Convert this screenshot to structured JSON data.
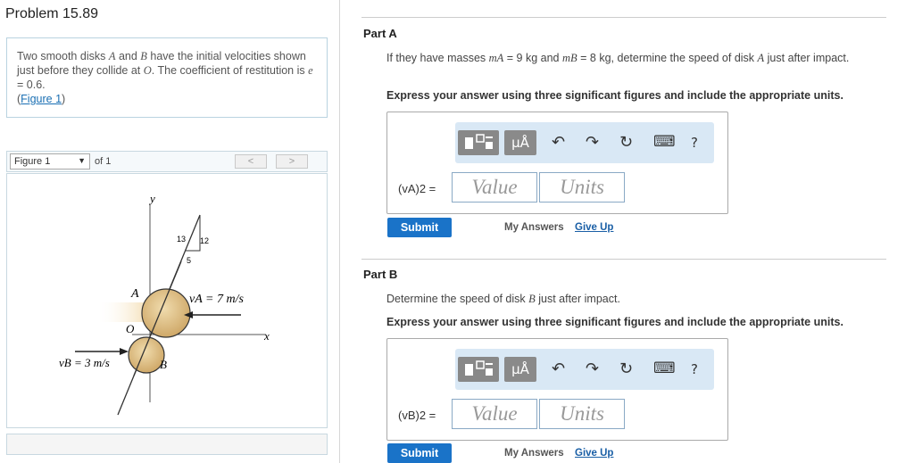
{
  "problem": {
    "title": "Problem 15.89"
  },
  "description": {
    "text1": "Two smooth disks ",
    "A": "A",
    "and": " and ",
    "B": "B",
    "text2": " have the initial velocities shown just before they collide at ",
    "O": "O",
    "text3": ". The coefficient of restitution is ",
    "e": "e",
    "text4": " = 0.6.",
    "open_paren": "(",
    "figure_link": "Figure 1",
    "close_paren": ")"
  },
  "figure_nav": {
    "selected": "Figure 1",
    "of_label": "of 1",
    "prev": "<",
    "next": ">"
  },
  "figure": {
    "label_y": "y",
    "label_x": "x",
    "label_A": "A",
    "label_B": "B",
    "label_O": "O",
    "slope_13": "13",
    "slope_12": "12",
    "slope_5": "5",
    "vA": "vA = 7 m/s",
    "vB": "vB = 3 m/s"
  },
  "partA": {
    "title": "Part A",
    "q1": "If they have masses ",
    "mA": "mA",
    "q2": " = 9 kg and ",
    "mB": "mB",
    "q3": " = 8 kg, determine the speed of disk ",
    "A": "A",
    "q4": " just after impact.",
    "instruction": "Express your answer using three significant figures and include the appropriate units.",
    "answer_label": "(vA)2 =",
    "value_placeholder": "Value",
    "units_placeholder": "Units",
    "submit": "Submit",
    "my_answers": "My Answers",
    "give_up": "Give Up"
  },
  "partB": {
    "title": "Part B",
    "q1": "Determine the speed of disk ",
    "B": "B",
    "q2": " just after impact.",
    "instruction": "Express your answer using three significant figures and include the appropriate units.",
    "answer_label": "(vB)2 =",
    "value_placeholder": "Value",
    "units_placeholder": "Units",
    "submit": "Submit",
    "my_answers": "My Answers",
    "give_up": "Give Up"
  },
  "toolbar": {
    "mu": "μÅ",
    "undo": "↶",
    "redo": "↷",
    "reset": "↻",
    "keyboard": "⌨",
    "help": "?"
  },
  "icons": [
    "template-icon",
    "undo-icon",
    "redo-icon",
    "reset-icon",
    "keyboard-icon",
    "help-icon"
  ],
  "colors": {
    "submit": "#1a73c8",
    "toolbar_bg": "#d9e8f5",
    "disk": "#dcc08a",
    "link": "#1a6fb3"
  }
}
